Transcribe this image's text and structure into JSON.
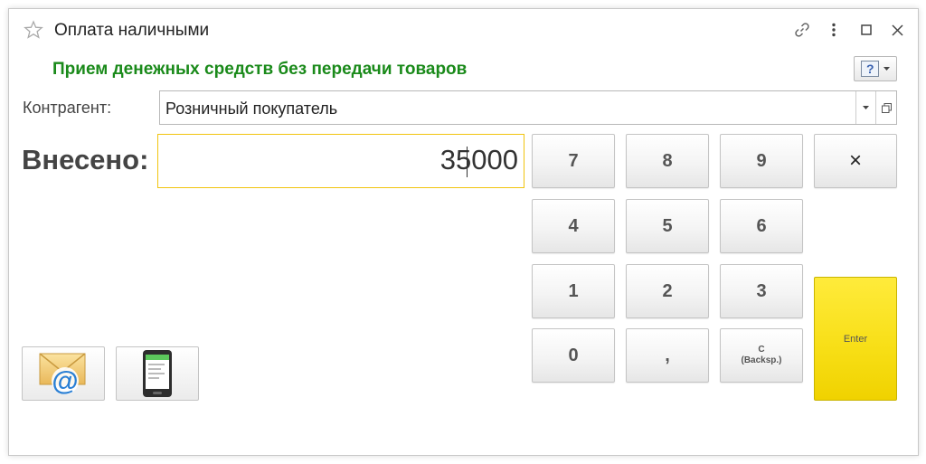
{
  "window": {
    "title": "Оплата наличными",
    "subtitle": "Прием денежных средств без передачи товаров"
  },
  "titlebar_icons": [
    "star-icon",
    "link-icon",
    "more-vertical-icon",
    "maximize-icon",
    "close-icon"
  ],
  "help_button": {
    "label": "?"
  },
  "counterparty": {
    "label": "Контрагент:",
    "value": "Розничный покупатель"
  },
  "deposit": {
    "label": "Внесено:",
    "value": "35000"
  },
  "keypad": {
    "k7": "7",
    "k8": "8",
    "k9": "9",
    "clear": "×",
    "k4": "4",
    "k5": "5",
    "k6": "6",
    "k1": "1",
    "k2": "2",
    "k3": "3",
    "k0": "0",
    "comma": ",",
    "backspace_line1": "C",
    "backspace_line2": "(Backsp.)",
    "enter": "Enter"
  },
  "share_buttons": [
    "email-icon",
    "phone-icon"
  ],
  "colors": {
    "subtitle": "#1a8a1a",
    "input_focus_border": "#f1c40f",
    "enter_bg": "#f7de15"
  }
}
